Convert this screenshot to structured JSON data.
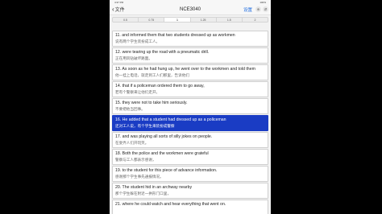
{
  "status": {
    "left": "4:37 PM",
    "right": "100%"
  },
  "nav": {
    "back_label": "文件",
    "title": "NCE3040",
    "settings_label": "设置",
    "btn1": "⊕",
    "btn2": "⇵"
  },
  "speeds": [
    "0.5",
    "0.75",
    "1",
    "1.25",
    "1.5",
    "2"
  ],
  "selected_speed": "1",
  "rows": [
    {
      "en": "11. and informed them that two students dressed up as workmen",
      "zh": "说有两个学生装扮成工人。"
    },
    {
      "en": "12. were tearing up the road with a pneumatic drill.",
      "zh": "正在用风钻破坏路面。"
    },
    {
      "en": "13. As soon as he had hung up, he went over to the workmen and told them",
      "zh": "他一挂上电话，就走到工人们那里，告诉他们"
    },
    {
      "en": "14. that if a policeman ordered them to go away,",
      "zh": "若有个警察来让他们走开，"
    },
    {
      "en": "15. they were not to take him seriously.",
      "zh": "不要把他当回事。"
    },
    {
      "en": "16. He added that a student had dressed up as a policeman",
      "zh": "还对工人说，有个学生来装扮成警察"
    },
    {
      "en": "17. and was playing all sorts of silly jokes on people.",
      "zh": "在耍弄人们开玩笑。"
    },
    {
      "en": "18. Both the police and the workmen were grateful",
      "zh": "警察与工人都表示感谢，"
    },
    {
      "en": "19. to the student for this piece of advance information.",
      "zh": "感谢那个学生事先通报情况。"
    },
    {
      "en": "20. The student hid in an archway nearby",
      "zh": "那个学生躲在附近一拱形门口里，"
    },
    {
      "en": "21. where he could watch and hear everything that went on.",
      "zh": ""
    }
  ],
  "highlighted_index": 5
}
